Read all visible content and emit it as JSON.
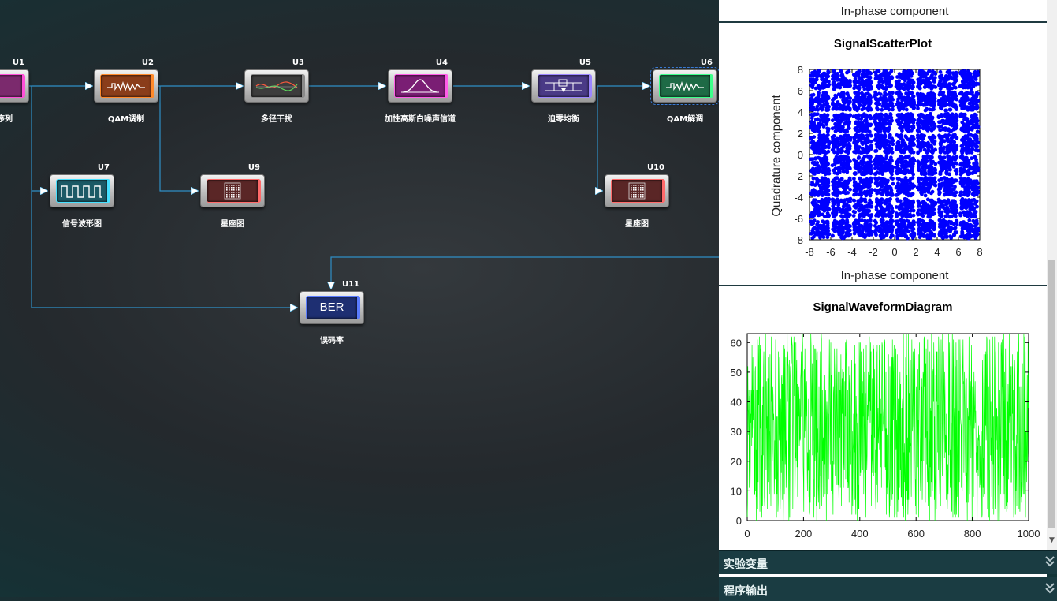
{
  "blocks": [
    {
      "id": "U1",
      "label": "控制序列",
      "screen": "#7b2a6d",
      "glow": "#ff4fd8",
      "icon": "pulse"
    },
    {
      "id": "U2",
      "label": "QAM调制",
      "screen": "#8a3d1a",
      "glow": "#ff8a2a",
      "icon": "qam"
    },
    {
      "id": "U3",
      "label": "多径干扰",
      "screen": "#3c3c3c",
      "glow": "#8a8a8a",
      "icon": "multipath"
    },
    {
      "id": "U4",
      "label": "加性高斯白噪声信道",
      "screen": "#7a1e74",
      "glow": "#ff5ce8",
      "icon": "gauss"
    },
    {
      "id": "U5",
      "label": "迫零均衡",
      "screen": "#4a3a86",
      "glow": "#9c86ff",
      "icon": "circuit"
    },
    {
      "id": "U6",
      "label": "QAM解调",
      "screen": "#1e6a46",
      "glow": "#3cff8a",
      "icon": "qam"
    },
    {
      "id": "U7",
      "label": "信号波形图",
      "screen": "#1c5a66",
      "glow": "#46e0ff",
      "icon": "square"
    },
    {
      "id": "U9",
      "label": "星座图",
      "screen": "#5a2626",
      "glow": "#ff6a6a",
      "icon": "grid"
    },
    {
      "id": "U10",
      "label": "星座图",
      "screen": "#5a2626",
      "glow": "#ff6a6a",
      "icon": "grid"
    },
    {
      "id": "U11",
      "label": "误码率",
      "screen": "#1e2f72",
      "glow": "#5a7cff",
      "icon": "ber",
      "text": "BER"
    }
  ],
  "panel": {
    "top_plot": {
      "xlabel": "In-phase component"
    },
    "scatter": {
      "title": "SignalScatterPlot",
      "xlabel": "In-phase component",
      "ylabel": "Quadrature component",
      "color": "#0000ff"
    },
    "waveform": {
      "title": "SignalWaveformDiagram",
      "color": "#00ff00"
    },
    "accordions": [
      {
        "label": "实验变量",
        "icon": "double-chevron-down-icon"
      },
      {
        "label": "程序输出",
        "icon": "double-chevron-down-icon"
      }
    ]
  },
  "chart_data": [
    {
      "type": "scatter",
      "title": "SignalScatterPlot",
      "xlabel": "In-phase component",
      "ylabel": "Quadrature component",
      "xlim": [
        -8,
        8
      ],
      "ylim": [
        -8,
        8
      ],
      "xticks": [
        -8,
        -6,
        -4,
        -2,
        0,
        2,
        4,
        6,
        8
      ],
      "yticks": [
        -8,
        -6,
        -4,
        -2,
        0,
        2,
        4,
        6,
        8
      ],
      "constellation": "64-QAM",
      "levels": [
        -7,
        -5,
        -3,
        -1,
        1,
        3,
        5,
        7
      ],
      "grid": true
    },
    {
      "type": "line",
      "title": "SignalWaveformDiagram",
      "xlabel": "",
      "ylabel": "",
      "xlim": [
        0,
        1000
      ],
      "ylim": [
        0,
        63
      ],
      "xticks": [
        0,
        200,
        400,
        600,
        800,
        1000
      ],
      "yticks": [
        0,
        10,
        20,
        30,
        40,
        50,
        60
      ],
      "n_points": 1000,
      "value_range": [
        0,
        63
      ],
      "grid": true
    }
  ]
}
